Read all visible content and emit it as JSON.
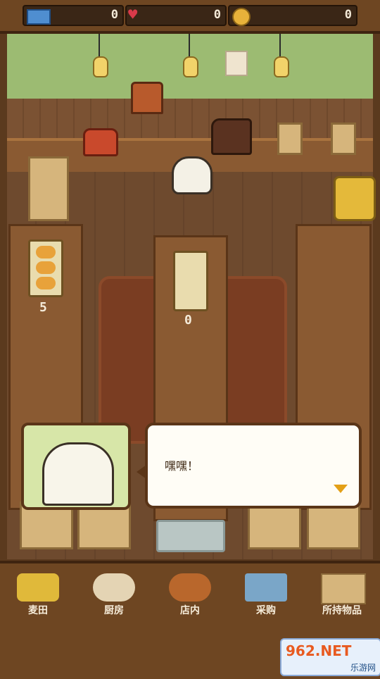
{
  "stats": {
    "tickets": "0",
    "hearts": "0",
    "coins": "0"
  },
  "counters": {
    "left_table": "5",
    "middle_table": "0"
  },
  "dialog": {
    "text": "嘿嘿！"
  },
  "nav": {
    "items": [
      {
        "label": "麦田"
      },
      {
        "label": "厨房"
      },
      {
        "label": "店内"
      },
      {
        "label": "采购"
      },
      {
        "label": "所持物品"
      }
    ]
  },
  "watermark": {
    "text": "962.NET",
    "sub": "乐游网"
  },
  "colors": {
    "accent": "#e3a017",
    "wall": "#9cbb72",
    "wood": "#8a5a32"
  }
}
